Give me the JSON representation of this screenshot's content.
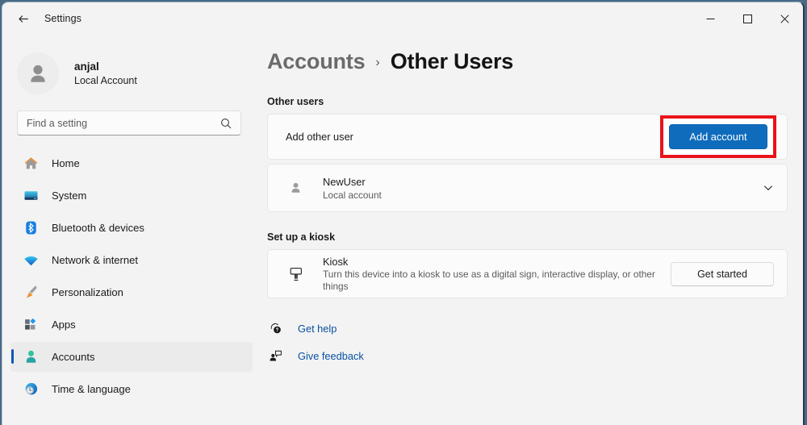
{
  "window": {
    "app_title": "Settings",
    "back_icon": "back-arrow-icon",
    "caption": {
      "minimize": "minimize-icon",
      "maximize": "maximize-icon",
      "close": "close-icon"
    }
  },
  "sidebar": {
    "profile": {
      "name": "anjal",
      "subtitle": "Local Account",
      "avatar_icon": "user-avatar-icon"
    },
    "search": {
      "placeholder": "Find a setting",
      "value": "",
      "icon": "search-icon"
    },
    "items": [
      {
        "label": "Home",
        "icon": "home-icon",
        "selected": false
      },
      {
        "label": "System",
        "icon": "system-icon",
        "selected": false
      },
      {
        "label": "Bluetooth & devices",
        "icon": "bluetooth-icon",
        "selected": false
      },
      {
        "label": "Network & internet",
        "icon": "wifi-icon",
        "selected": false
      },
      {
        "label": "Personalization",
        "icon": "paintbrush-icon",
        "selected": false
      },
      {
        "label": "Apps",
        "icon": "apps-icon",
        "selected": false
      },
      {
        "label": "Accounts",
        "icon": "accounts-icon",
        "selected": true
      },
      {
        "label": "Time & language",
        "icon": "clock-globe-icon",
        "selected": false
      }
    ]
  },
  "main": {
    "breadcrumb": {
      "parent": "Accounts",
      "separator": "›",
      "current": "Other Users"
    },
    "other_users": {
      "section_title": "Other users",
      "add_user": {
        "label": "Add other user",
        "button_label": "Add account",
        "button_color": "#0f6cbd",
        "highlight_color": "#e8131b",
        "highlighted": true
      },
      "user_row": {
        "name": "NewUser",
        "subtitle": "Local account",
        "avatar_icon": "user-avatar-icon",
        "expand_icon": "chevron-down-icon"
      }
    },
    "kiosk": {
      "section_title": "Set up a kiosk",
      "title": "Kiosk",
      "description": "Turn this device into a kiosk to use as a digital sign, interactive display, or other things",
      "icon": "kiosk-display-icon",
      "button_label": "Get started"
    },
    "footer_links": [
      {
        "label": "Get help",
        "icon": "help-icon"
      },
      {
        "label": "Give feedback",
        "icon": "feedback-icon"
      }
    ]
  }
}
